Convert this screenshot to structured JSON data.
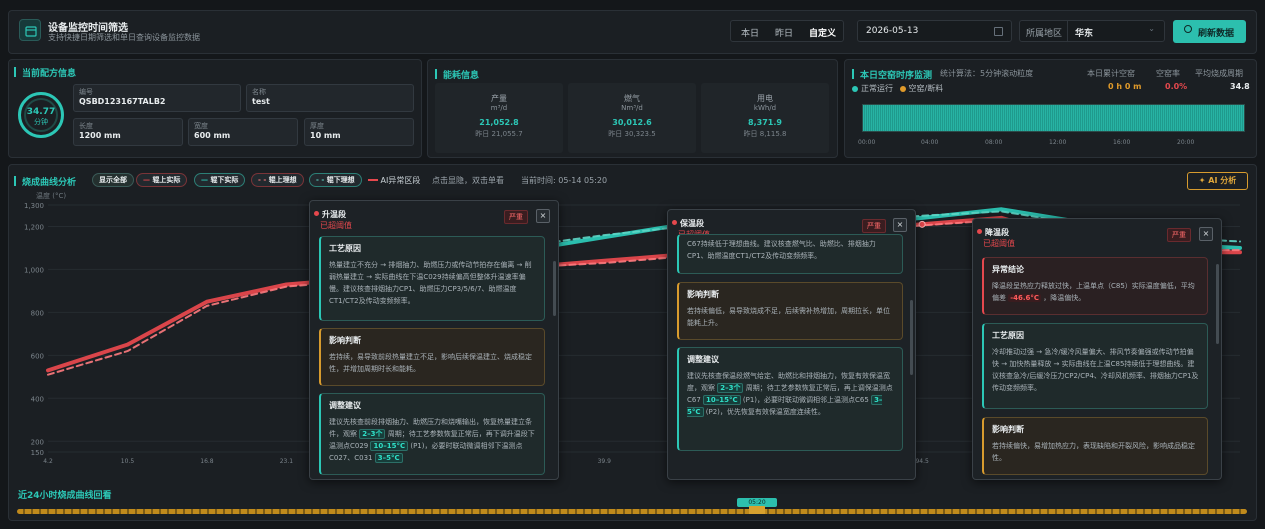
{
  "header": {
    "title": "设备监控时间筛选",
    "subtitle": "支持快捷日期筛选和单日查询设备监控数据",
    "quick_dates": [
      "本日",
      "昨日",
      "自定义"
    ],
    "date_value": "2026-05-13",
    "region_label": "所属地区",
    "region_value": "华东",
    "refresh_label": "刷新数据"
  },
  "recipe": {
    "title": "当前配方信息",
    "ring_value": "34.77",
    "ring_unit": "分钟",
    "code_label": "编号",
    "code_value": "QSBD123167TALB2",
    "name_label": "名称",
    "name_value": "test",
    "length_label": "长度",
    "length_value": "1200 mm",
    "width_label": "宽度",
    "width_value": "600 mm",
    "thick_label": "厚度",
    "thick_value": "10 mm"
  },
  "energy": {
    "title": "能耗信息",
    "items": [
      {
        "name": "产量",
        "unit": "m³/d",
        "value": "21,052.8",
        "yesterday": "昨日 21,055.7"
      },
      {
        "name": "燃气",
        "unit": "Nm³/d",
        "value": "30,012.6",
        "yesterday": "昨日 30,323.5"
      },
      {
        "name": "用电",
        "unit": "kWh/d",
        "value": "8,371.9",
        "yesterday": "昨日 8,115.8"
      }
    ]
  },
  "kiln": {
    "title": "本日空窑时序监测",
    "algo": "统计算法：5分钟滚动粒度",
    "legend_normal": "正常运行",
    "legend_empty": "空窑/断料",
    "stat1_label": "本日累计空窑",
    "stat1_value": "0 h 0 m",
    "stat2_label": "空窑率",
    "stat2_value": "0.0%",
    "stat3_label": "平均烧成周期",
    "stat3_value": "34.8",
    "ticks": [
      "00:00",
      "04:00",
      "08:00",
      "12:00",
      "16:00",
      "20:00"
    ]
  },
  "curve": {
    "title": "烧成曲线分析",
    "chips": [
      "显示全部",
      "辊上实际",
      "辊下实际",
      "辊上理想",
      "辊下理想"
    ],
    "anomaly_label": "AI异常区段",
    "hint": "点击显隐，双击单看",
    "current_time": "当前时间: 05-14 05:20",
    "ai_button": "AI 分析",
    "y_unit": "温度 (°C)",
    "history_title": "近24小时烧成曲线回看",
    "history_marker": "05:20"
  },
  "popups": [
    {
      "title": "升温段",
      "sub": "已超阈值",
      "badge": "严重",
      "cards": [
        {
          "type": "t",
          "title": "工艺原因",
          "text": "热量建立不充分 → 排烟抽力、助燃压力或传动节拍存在偏离 → 削弱热量建立 → 实际曲线在下温C029持续偏高但整体升温速率偏慢。建议核查排烟抽力CP1、助燃压力CP3/5/6/7、助燃温度CT1/CT2及传动变频频率。"
        },
        {
          "type": "o",
          "title": "影响判断",
          "text": "若持续，易导致前段热量建立不足，影响后续保温建立、烧成稳定性，并增加周期时长和能耗。"
        },
        {
          "type": "t",
          "title": "调整建议",
          "text_a": "建议先核查前段排烟抽力、助燃压力和烧嘴输出，恢复热量建立条件，观察",
          "hl1": "2–3个",
          "text_b": "周期；待工艺参数恢复正常后，再下调升温段下温测点C029",
          "hl2": "10–15°C",
          "text_c": "(P1)，必要时联动微调相邻下温测点C027、C031",
          "hl3": "3–5°C"
        }
      ]
    },
    {
      "title": "保温段",
      "sub": "已超阈值",
      "badge": "严重",
      "cards": [
        {
          "type": "t",
          "title": "",
          "text": "C67持续低于理想曲线。建议核查燃气比、助燃比、排烟抽力CP1、助燃温度CT1/CT2及传动变频频率。"
        },
        {
          "type": "o",
          "title": "影响判断",
          "text": "若持续偏低，易导致烧成不足，后续需补热增加，周期拉长，单位能耗上升。"
        },
        {
          "type": "t",
          "title": "调整建议",
          "text_a": "建议先核查保温段燃气给定、助燃比和排烟抽力，恢复有效保温宽度，观察",
          "hl1": "2–3个",
          "text_b": "周期；待工艺参数恢复正常后，再上调保温测点C67",
          "hl2": "10–15°C",
          "text_c": "(P1)，必要时联动微调相邻上温测点C65",
          "hl3": "3–5°C",
          "text_d": "(P2)，优先恢复有效保温宽度连续性。"
        }
      ]
    },
    {
      "title": "降温段",
      "sub": "已超阈值",
      "badge": "严重",
      "cards": [
        {
          "type": "r",
          "title": "异常结论",
          "text_a": "降温段呈热应力释放过快，上温单点（C85）实际温度偏低，平均偏差",
          "hl1": "-46.6°C",
          "text_b": "，降温偏快。"
        },
        {
          "type": "t",
          "title": "工艺原因",
          "text": "冷却推动过强 → 急冷/缓冷风量偏大、排风节奏偏强或传动节拍偏快 → 加快热量释放 → 实际曲线在上温C85持续低于理想曲线。建议核查急冷/后缓冷压力CP2/CP4、冷却风机频率、排烟抽力CP1及传动变频频率。"
        },
        {
          "type": "o",
          "title": "影响判断",
          "text": "若持续偏快，易增加热应力，表现缺陷和开裂风险，影响成品稳定性。"
        }
      ]
    }
  ],
  "chart_data": {
    "type": "line",
    "title": "烧成曲线分析",
    "ylabel": "温度 (°C)",
    "ylim": [
      150,
      1300
    ],
    "yticks": [
      150,
      200,
      400,
      600,
      800,
      1000,
      1200,
      1300
    ],
    "x_labels": [
      "4.2",
      "10.5",
      "16.8",
      "23.1",
      "27.3",
      "31.5",
      "35.7",
      "39.9",
      "44.1",
      "86.1",
      "90.3",
      "94.5",
      "98.7",
      "136.5",
      "140.7"
    ],
    "x": [
      4.2,
      10.5,
      16.8,
      23.1,
      27.3,
      31.5,
      35.7,
      39.9,
      44.1,
      86.1,
      90.3,
      94.5,
      98.7,
      136.5,
      140.7,
      147
    ],
    "series": [
      {
        "name": "辊上实际",
        "color": "#2cc7b6",
        "values": [
          null,
          null,
          null,
          null,
          990,
          1030,
          1090,
          1150,
          1210,
          1180,
          1210,
          1240,
          1280,
          1220,
          1120,
          1100
        ]
      },
      {
        "name": "辊下实际",
        "color": "#e5484d",
        "values": [
          530,
          650,
          850,
          930,
          960,
          990,
          1010,
          1040,
          1070,
          1165,
          1180,
          1210,
          1240,
          1130,
          1080,
          1080
        ]
      },
      {
        "name": "辊上理想",
        "color": "#5fd6c6",
        "values": [
          null,
          null,
          null,
          null,
          1000,
          1070,
          1110,
          1160,
          1200,
          1190,
          1220,
          1250,
          1270,
          1210,
          1150,
          1130
        ]
      },
      {
        "name": "辊下理想",
        "color": "#ff7a7e",
        "values": [
          510,
          620,
          830,
          920,
          950,
          980,
          1010,
          1030,
          1060,
          1160,
          1175,
          1205,
          1230,
          1140,
          1090,
          1090
        ]
      }
    ]
  },
  "colors": {
    "accent": "#2cc7b6",
    "danger": "#e5484d",
    "warn": "#d79b2e",
    "bg": "#14171a"
  }
}
